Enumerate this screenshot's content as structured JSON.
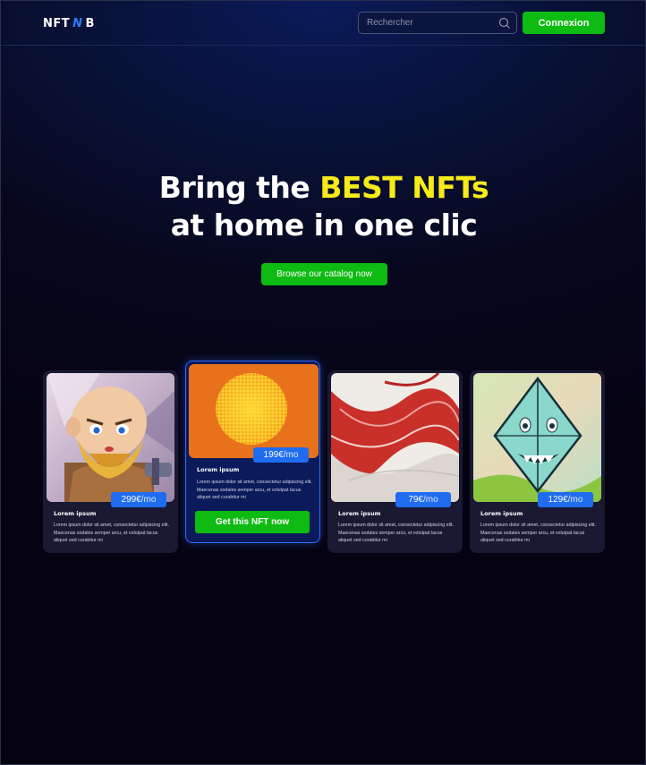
{
  "header": {
    "logo": {
      "left": "NFT",
      "middle": "N",
      "right": "B"
    },
    "search": {
      "placeholder": "Rechercher",
      "icon": "search-icon"
    },
    "login_label": "Connexion"
  },
  "hero": {
    "line1_prefix": "Bring the ",
    "line1_highlight": "BEST NFTs",
    "line2": "at home in one clic",
    "cta_label": "Browse our catalog now"
  },
  "colors": {
    "accent_green": "#0dbb12",
    "highlight_yellow": "#f6ea1a",
    "price_blue": "#1f6cf0"
  },
  "cards": [
    {
      "price": "299€",
      "unit": "/mo",
      "title": "Lorem ipsum",
      "description": "Lorem ipsum dolor sit amet, consectetur adipiscing elit. Maecenas sodales semper arcu, et volutpat lacus aliquet sed curabitur mi",
      "art": "cartoon-warrior-nft"
    },
    {
      "price": "199€",
      "unit": "/mo",
      "title": "Lorem ipsum",
      "description": "Lorem ipsum dolor sit amet, consectetur adipiscing elit. Maecenas sodales semper arcu, et volutpat lacus aliquet sed curabitur mi",
      "art": "halftone-sun-nft",
      "cta_label": "Get this NFT now"
    },
    {
      "price": "79€",
      "unit": "/mo",
      "title": "Lorem ipsum",
      "description": "Lorem ipsum dolor sit amet, consectetur adipiscing elit. Maecenas sodales semper arcu, et volutpat lacus aliquet sed curabitur mi",
      "art": "red-wave-abstract-nft"
    },
    {
      "price": "129€",
      "unit": "/mo",
      "title": "Lorem ipsum",
      "description": "Lorem ipsum dolor sit amet, consectetur adipiscing elit. Maecenas sodales semper arcu, et volutpat lacus aliquet sed curabitur mi",
      "art": "crystal-monster-nft"
    }
  ]
}
